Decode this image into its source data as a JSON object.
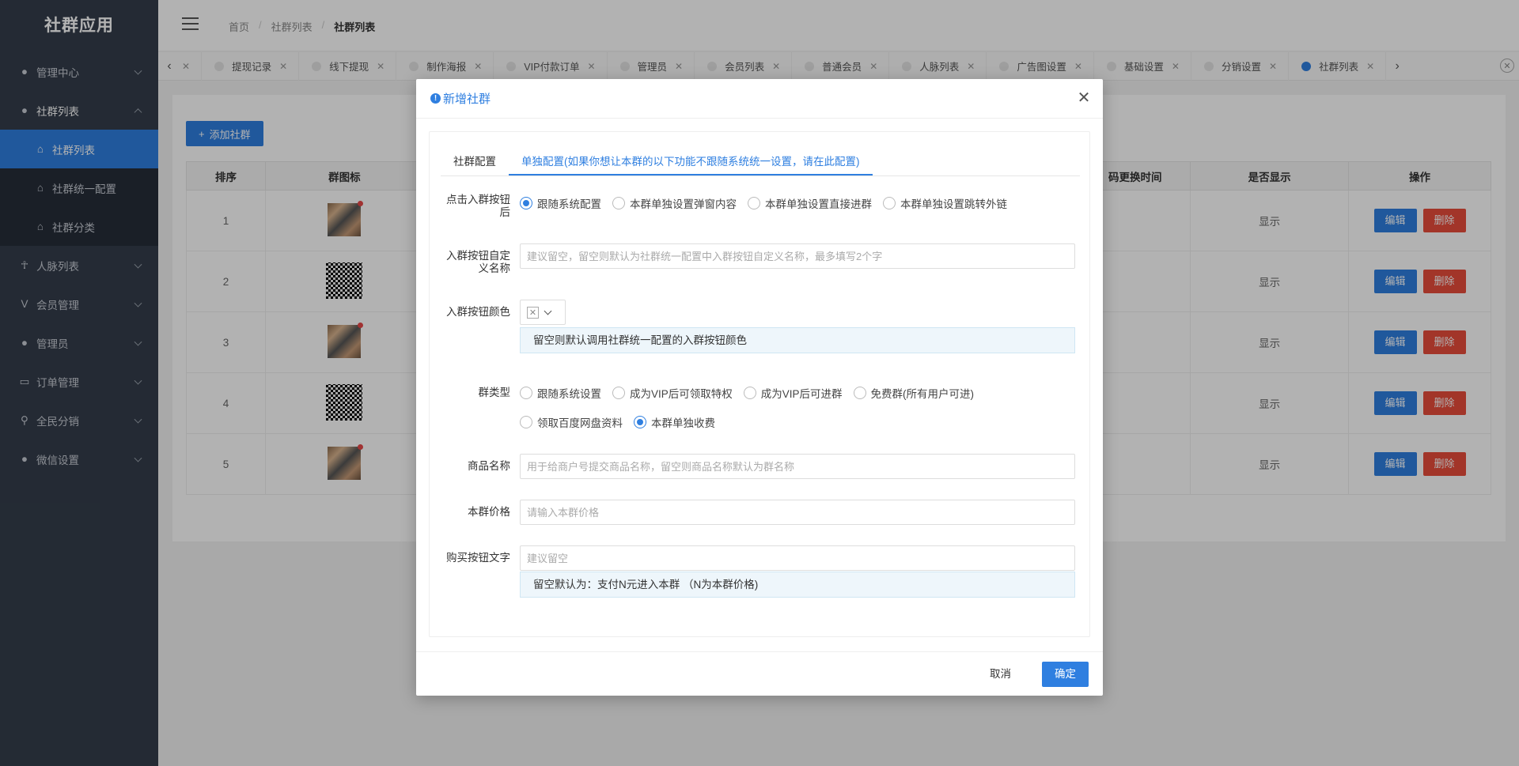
{
  "app": {
    "title": "社群应用"
  },
  "sidebar": {
    "items": [
      {
        "label": "管理中心",
        "icon": "circle-icon"
      },
      {
        "label": "社群列表",
        "icon": "chat-bubble-icon",
        "expanded": true,
        "children": [
          {
            "label": "社群列表",
            "active": true
          },
          {
            "label": "社群统一配置"
          },
          {
            "label": "社群分类"
          }
        ]
      },
      {
        "label": "人脉列表",
        "icon": "person-icon"
      },
      {
        "label": "会员管理",
        "icon": "vip-icon"
      },
      {
        "label": "管理员",
        "icon": "user-icon"
      },
      {
        "label": "订单管理",
        "icon": "card-icon"
      },
      {
        "label": "全民分销",
        "icon": "bike-icon"
      },
      {
        "label": "微信设置",
        "icon": "chat-bubble-icon"
      }
    ]
  },
  "header": {
    "breadcrumb": [
      "首页",
      "社群列表",
      "社群列表"
    ]
  },
  "tabs": [
    {
      "label": ""
    },
    {
      "label": "提现记录"
    },
    {
      "label": "线下提现"
    },
    {
      "label": "制作海报"
    },
    {
      "label": "VIP付款订单"
    },
    {
      "label": "管理员"
    },
    {
      "label": "会员列表"
    },
    {
      "label": "普通会员"
    },
    {
      "label": "人脉列表"
    },
    {
      "label": "广告图设置"
    },
    {
      "label": "基础设置"
    },
    {
      "label": "分销设置"
    },
    {
      "label": "社群列表",
      "active": true
    }
  ],
  "page": {
    "add_button": "添加社群",
    "columns": [
      "排序",
      "群图标",
      "",
      "码更换时间",
      "是否显示",
      "操作"
    ],
    "rows": [
      {
        "order": "1",
        "show": "显示"
      },
      {
        "order": "2",
        "show": "显示"
      },
      {
        "order": "3",
        "show": "显示"
      },
      {
        "order": "4",
        "show": "显示"
      },
      {
        "order": "5",
        "show": "显示"
      }
    ],
    "edit_label": "编辑",
    "delete_label": "删除"
  },
  "modal": {
    "title": "新增社群",
    "tabs": [
      "社群配置",
      "单独配置(如果你想让本群的以下功能不跟随系统统一设置，请在此配置)"
    ],
    "join_action": {
      "label": "点击入群按钮后",
      "options": [
        "跟随系统配置",
        "本群单独设置弹窗内容",
        "本群单独设置直接进群",
        "本群单独设置跳转外链"
      ],
      "selected": 0
    },
    "button_name": {
      "label": "入群按钮自定义名称",
      "placeholder": "建议留空，留空则默认为社群统一配置中入群按钮自定义名称，最多填写2个字"
    },
    "button_color": {
      "label": "入群按钮颜色",
      "hint": "留空则默认调用社群统一配置的入群按钮颜色"
    },
    "group_type": {
      "label": "群类型",
      "options": [
        "跟随系统设置",
        "成为VIP后可领取特权",
        "成为VIP后可进群",
        "免费群(所有用户可进)",
        "领取百度网盘资料",
        "本群单独收费"
      ],
      "selected": 5
    },
    "product_name": {
      "label": "商品名称",
      "placeholder": "用于给商户号提交商品名称，留空则商品名称默认为群名称"
    },
    "price": {
      "label": "本群价格",
      "placeholder": "请输入本群价格"
    },
    "buy_text": {
      "label": "购买按钮文字",
      "placeholder": "建议留空",
      "hint": "留空默认为：支付N元进入本群 （N为本群价格)"
    },
    "cancel": "取消",
    "confirm": "确定"
  }
}
